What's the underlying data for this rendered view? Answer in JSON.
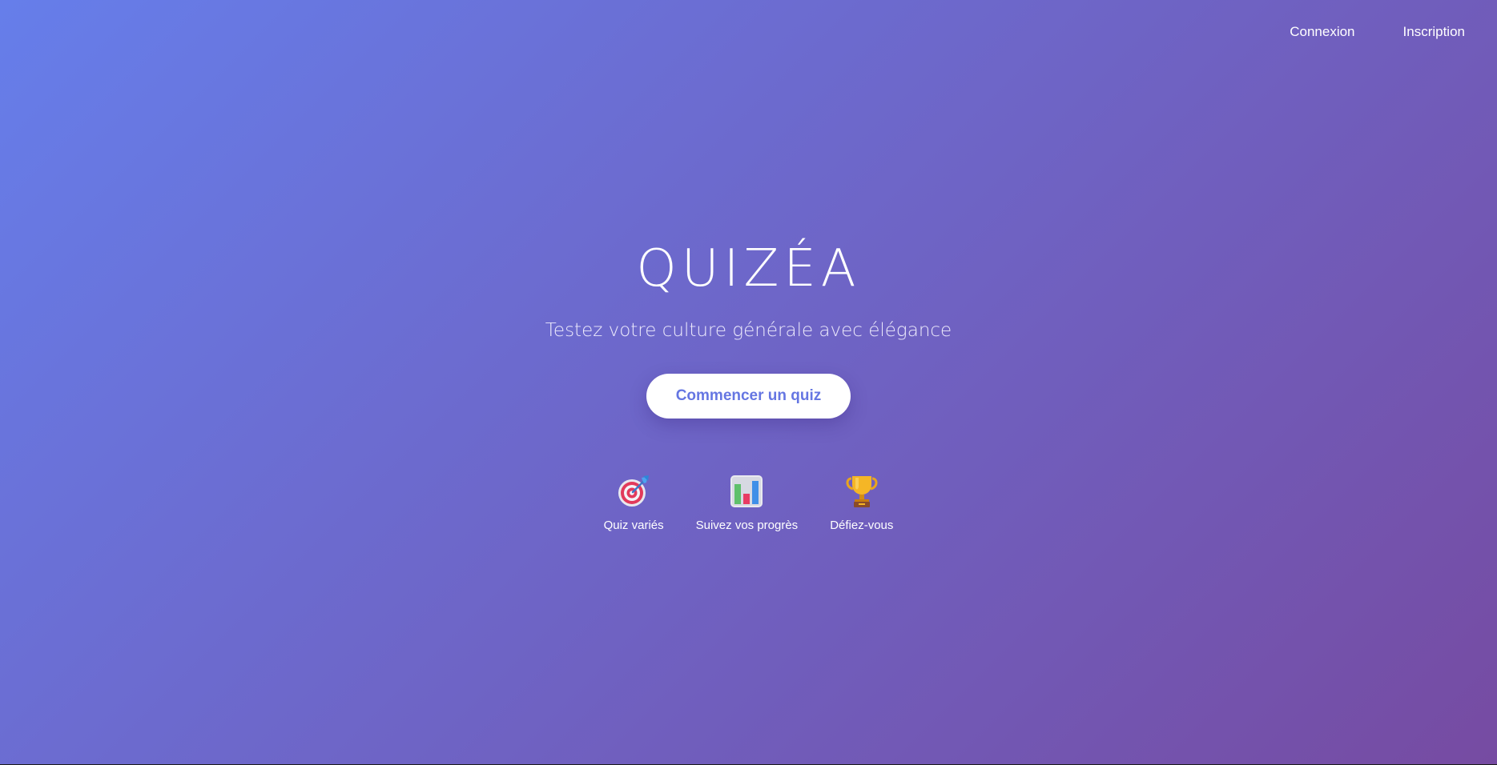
{
  "nav": {
    "login_label": "Connexion",
    "signup_label": "Inscription"
  },
  "hero": {
    "title": "QUIZÉA",
    "tagline": "Testez votre culture générale avec élégance",
    "cta_label": "Commencer un quiz"
  },
  "features": [
    {
      "icon": "target-dart-icon",
      "label": "Quiz variés"
    },
    {
      "icon": "bar-chart-icon",
      "label": "Suivez vos progrès"
    },
    {
      "icon": "trophy-icon",
      "label": "Défiez-vous"
    }
  ],
  "colors": {
    "gradient_start": "#667eea",
    "gradient_end": "#764ba2",
    "cta_text": "#6576e2",
    "cta_background": "#ffffff"
  }
}
